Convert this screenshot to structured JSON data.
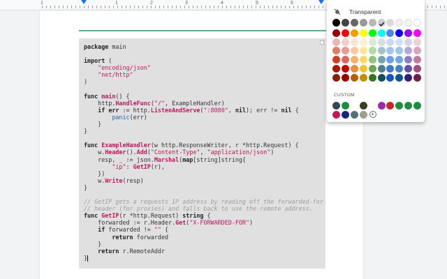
{
  "ruler": {
    "numbers": [
      "1",
      "1",
      "2",
      "3",
      "4",
      "5",
      "6"
    ]
  },
  "code": {
    "lines": [
      [
        {
          "t": "package",
          "c": "kw"
        },
        {
          "t": " main"
        }
      ],
      [],
      [
        {
          "t": "import",
          "c": "kw"
        },
        {
          "t": " ("
        }
      ],
      [
        {
          "t": "    "
        },
        {
          "t": "\"encoding/json\"",
          "c": "str"
        }
      ],
      [
        {
          "t": "    "
        },
        {
          "t": "\"net/http\"",
          "c": "str"
        }
      ],
      [
        {
          "t": ")"
        }
      ],
      [],
      [
        {
          "t": "func",
          "c": "kw"
        },
        {
          "t": " "
        },
        {
          "t": "main",
          "c": "fn"
        },
        {
          "t": "() {"
        }
      ],
      [
        {
          "t": "    http."
        },
        {
          "t": "HandleFunc",
          "c": "fn"
        },
        {
          "t": "("
        },
        {
          "t": "\"/\"",
          "c": "str"
        },
        {
          "t": ", ExampleHandler)"
        }
      ],
      [
        {
          "t": "    "
        },
        {
          "t": "if",
          "c": "kw"
        },
        {
          "t": " "
        },
        {
          "t": "err",
          "c": "kw"
        },
        {
          "t": " := http."
        },
        {
          "t": "ListenAndServe",
          "c": "fn"
        },
        {
          "t": "("
        },
        {
          "t": "\":8080\"",
          "c": "str"
        },
        {
          "t": ", "
        },
        {
          "t": "nil",
          "c": "kw"
        },
        {
          "t": "); err != "
        },
        {
          "t": "nil",
          "c": "kw"
        },
        {
          "t": " {"
        }
      ],
      [
        {
          "t": "        "
        },
        {
          "t": "panic",
          "c": "bi"
        },
        {
          "t": "(err)"
        }
      ],
      [
        {
          "t": "    }"
        }
      ],
      [
        {
          "t": "}"
        }
      ],
      [],
      [
        {
          "t": "func",
          "c": "kw"
        },
        {
          "t": " "
        },
        {
          "t": "ExampleHandler",
          "c": "fn"
        },
        {
          "t": "(w http.ResponseWriter, r *http.Request) {"
        }
      ],
      [
        {
          "t": "    w."
        },
        {
          "t": "Header",
          "c": "fn"
        },
        {
          "t": "()."
        },
        {
          "t": "Add",
          "c": "fn"
        },
        {
          "t": "("
        },
        {
          "t": "\"Content-Type\"",
          "c": "str"
        },
        {
          "t": ", "
        },
        {
          "t": "\"application/json\"",
          "c": "str"
        },
        {
          "t": ")"
        }
      ],
      [
        {
          "t": "    resp, _ := json."
        },
        {
          "t": "Marshal",
          "c": "fn"
        },
        {
          "t": "("
        },
        {
          "t": "map",
          "c": "kw"
        },
        {
          "t": "[string]string{"
        }
      ],
      [
        {
          "t": "        "
        },
        {
          "t": "\"ip\"",
          "c": "str"
        },
        {
          "t": ": "
        },
        {
          "t": "GetIP",
          "c": "fn"
        },
        {
          "t": "(r),"
        }
      ],
      [
        {
          "t": "    })"
        }
      ],
      [
        {
          "t": "    w."
        },
        {
          "t": "Write",
          "c": "fn"
        },
        {
          "t": "(resp)"
        }
      ],
      [
        {
          "t": "}"
        }
      ],
      [],
      [
        {
          "t": "// GetIP gets a requests IP address by reading off the forwarded-for",
          "c": "cm"
        }
      ],
      [
        {
          "t": "// header (for proxies) and falls back to use the remote address.",
          "c": "cm"
        }
      ],
      [
        {
          "t": "func",
          "c": "kw"
        },
        {
          "t": " "
        },
        {
          "t": "GetIP",
          "c": "fn"
        },
        {
          "t": "(r *http.Request) "
        },
        {
          "t": "string",
          "c": "kw"
        },
        {
          "t": " {"
        }
      ],
      [
        {
          "t": "    forwarded := r.Header."
        },
        {
          "t": "Get",
          "c": "fn"
        },
        {
          "t": "("
        },
        {
          "t": "\"X-FORWARDED-FOR\"",
          "c": "str"
        },
        {
          "t": ")"
        }
      ],
      [
        {
          "t": "    "
        },
        {
          "t": "if",
          "c": "kw"
        },
        {
          "t": " forwarded != "
        },
        {
          "t": "\"\"",
          "c": "str"
        },
        {
          "t": " {"
        }
      ],
      [
        {
          "t": "        "
        },
        {
          "t": "return",
          "c": "kw"
        },
        {
          "t": " forwarded"
        }
      ],
      [
        {
          "t": "    }"
        }
      ],
      [
        {
          "t": "    "
        },
        {
          "t": "return",
          "c": "kw"
        },
        {
          "t": " r.RemoteAddr"
        }
      ],
      [
        {
          "t": "}"
        }
      ]
    ]
  },
  "palette": {
    "transparent_label": "Transparent",
    "custom_label": "CUSTOM",
    "add_symbol": "+",
    "selected_color": "#cccccc",
    "rows": [
      [
        "#000000",
        "#434343",
        "#666666",
        "#999999",
        "#b7b7b7",
        "#cccccc",
        "#d9d9d9",
        "#efefef",
        "#f3f3f3",
        "#ffffff"
      ],
      [
        "#980000",
        "#ff0000",
        "#ff9900",
        "#ffff00",
        "#00ff00",
        "#00ffff",
        "#4a86e8",
        "#0000ff",
        "#9900ff",
        "#ff00ff"
      ],
      [
        "#e6b8af",
        "#f4cccc",
        "#fce5cd",
        "#fff2cc",
        "#d9ead3",
        "#d0e0e3",
        "#c9daf8",
        "#cfe2f3",
        "#d9d2e9",
        "#ead1dc"
      ],
      [
        "#dd7e6b",
        "#ea9999",
        "#f9cb9c",
        "#ffe599",
        "#b6d7a8",
        "#a2c4c9",
        "#a4c2f4",
        "#9fc5e8",
        "#b4a7d6",
        "#d5a6bd"
      ],
      [
        "#cc4125",
        "#e06666",
        "#f6b26b",
        "#ffd966",
        "#93c47d",
        "#76a5af",
        "#6d9eeb",
        "#6fa8dc",
        "#8e7cc3",
        "#c27ba0"
      ],
      [
        "#a61c00",
        "#cc0000",
        "#e69138",
        "#f1c232",
        "#6aa84f",
        "#45818e",
        "#3c78d8",
        "#3d85c6",
        "#674ea7",
        "#a64d79"
      ],
      [
        "#85200c",
        "#990000",
        "#b45f06",
        "#bf9000",
        "#38761d",
        "#134f5c",
        "#1155cc",
        "#0b5394",
        "#351c75",
        "#741b47"
      ]
    ],
    "custom_rows": [
      [
        "#37474f",
        "#1e8e3e",
        "#ffffff",
        "#3c3c1e",
        "#ffffff",
        "#9c27b0",
        "#c62828",
        "#1e8e3e",
        "#1e8e3e",
        "#1e8e3e"
      ],
      [
        "#c2185b",
        "#1a237e",
        "#546e7a",
        "#9e9e8e"
      ]
    ]
  }
}
